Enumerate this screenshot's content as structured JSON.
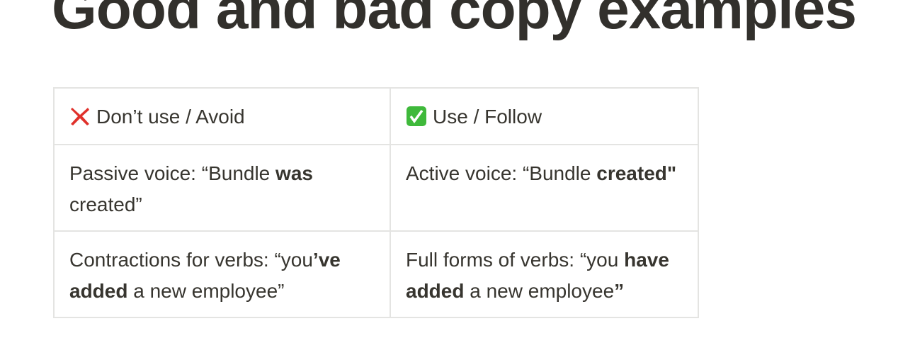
{
  "heading": "Good and bad copy examples",
  "table": {
    "header": {
      "avoid": {
        "icon": "red-cross-mark-icon",
        "label": "Don’t use / Avoid"
      },
      "use": {
        "icon": "green-check-box-icon",
        "label": "Use / Follow"
      }
    },
    "rows": [
      {
        "avoid": [
          {
            "t": "Passive voice: “Bundle "
          },
          {
            "t": "was",
            "b": true
          },
          {
            "t": " created”"
          }
        ],
        "use": [
          {
            "t": "Active voice: “Bundle "
          },
          {
            "t": "created\"",
            "b": true
          }
        ]
      },
      {
        "avoid": [
          {
            "t": "Contractions for verbs: “you"
          },
          {
            "t": "’ve added",
            "b": true
          },
          {
            "t": " a new employee”"
          }
        ],
        "use": [
          {
            "t": "Full forms of verbs: “you "
          },
          {
            "t": "have added",
            "b": true
          },
          {
            "t": " a new employee"
          },
          {
            "t": "”",
            "b": true
          }
        ]
      }
    ]
  },
  "colors": {
    "text": "#37352f",
    "border": "#e4e4e2",
    "cross": "#e0312b",
    "check": "#3fb93b"
  }
}
